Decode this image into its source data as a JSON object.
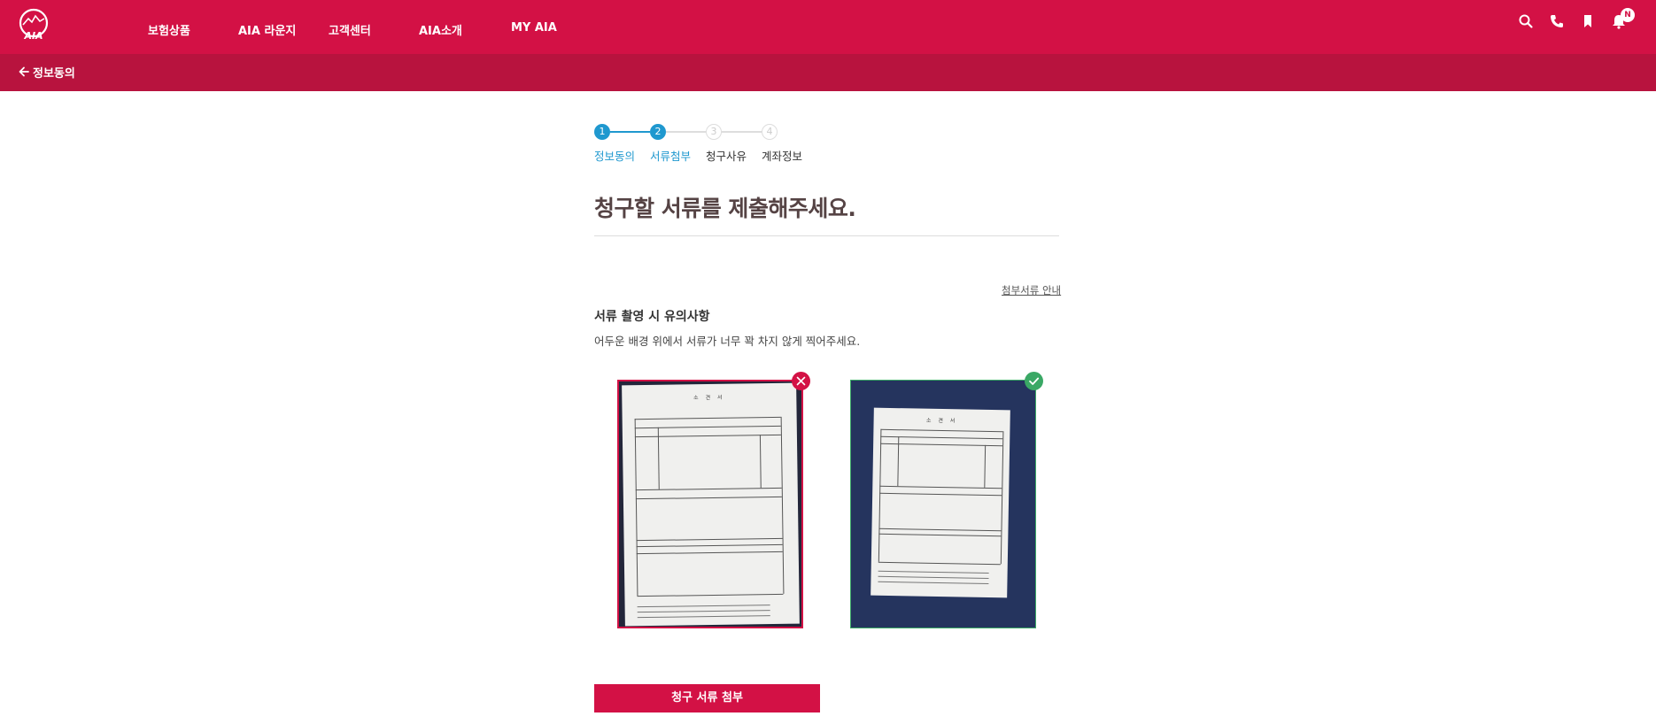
{
  "brand": {
    "logo_text": "AIA",
    "primary_color": "#d31145",
    "subbar_color": "#b8133e",
    "step_active_color": "#1f98cf",
    "success_color": "#3aa865"
  },
  "nav": {
    "items": [
      {
        "label": "보험상품"
      },
      {
        "label": "AIA 라운지"
      },
      {
        "label": "고객센터"
      },
      {
        "label": "AIA소개"
      },
      {
        "label": "MY AIA"
      }
    ],
    "icons": [
      "search-icon",
      "phone-icon",
      "bookmark-icon",
      "bell-icon"
    ],
    "notification_badge": "N"
  },
  "subbar": {
    "back_label": "정보동의"
  },
  "stepper": {
    "steps": [
      {
        "number": "1",
        "label": "정보동의",
        "state": "active"
      },
      {
        "number": "2",
        "label": "서류첨부",
        "state": "active"
      },
      {
        "number": "3",
        "label": "청구사유",
        "state": "inactive"
      },
      {
        "number": "4",
        "label": "계좌정보",
        "state": "inactive"
      }
    ]
  },
  "main": {
    "heading": "청구할 서류를 제출해주세요.",
    "guide_link": "첨부서류 안내",
    "tips_title": "서류 촬영 시 유의사항",
    "tips_desc": "어두운 배경 위에서 서류가 너무 꽉 차지 않게 찍어주세요.",
    "examples": [
      {
        "kind": "bad",
        "doc_title": "소 견 서",
        "mark_icon": "x-icon"
      },
      {
        "kind": "good",
        "doc_title": "소 견 서",
        "mark_icon": "check-icon"
      }
    ],
    "submit_label": "청구 서류 첨부"
  }
}
